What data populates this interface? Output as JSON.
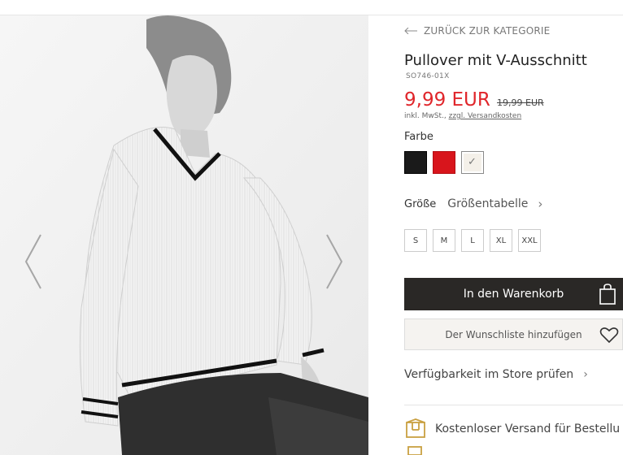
{
  "back_label": "ZURÜCK ZUR KATEGORIE",
  "product": {
    "title": "Pullover mit V-Ausschnitt",
    "sku": "SO746-01X",
    "price": "9,99 EUR",
    "old_price": "19,99 EUR",
    "vat_prefix": "inkl. MwSt., ",
    "shipping_link": "zzgl. Versandkosten"
  },
  "color": {
    "label": "Farbe",
    "swatches": [
      {
        "name": "black",
        "hex": "#1a1a1a"
      },
      {
        "name": "red",
        "hex": "#d8151c"
      },
      {
        "name": "white",
        "hex": "#f4f0e9",
        "selected": true
      }
    ]
  },
  "size": {
    "label": "Größe",
    "chart_label": "Größentabelle",
    "options": [
      "S",
      "M",
      "L",
      "XL",
      "XXL"
    ]
  },
  "actions": {
    "add_to_cart": "In den Warenkorb",
    "wishlist": "Der Wunschliste hinzufügen",
    "store_availability": "Verfügbarkeit im Store prüfen"
  },
  "benefits": {
    "free_shipping": "Kostenloser Versand für Bestellu"
  },
  "colors": {
    "price_red": "#e0262b",
    "cart_button": "#2a2826"
  }
}
